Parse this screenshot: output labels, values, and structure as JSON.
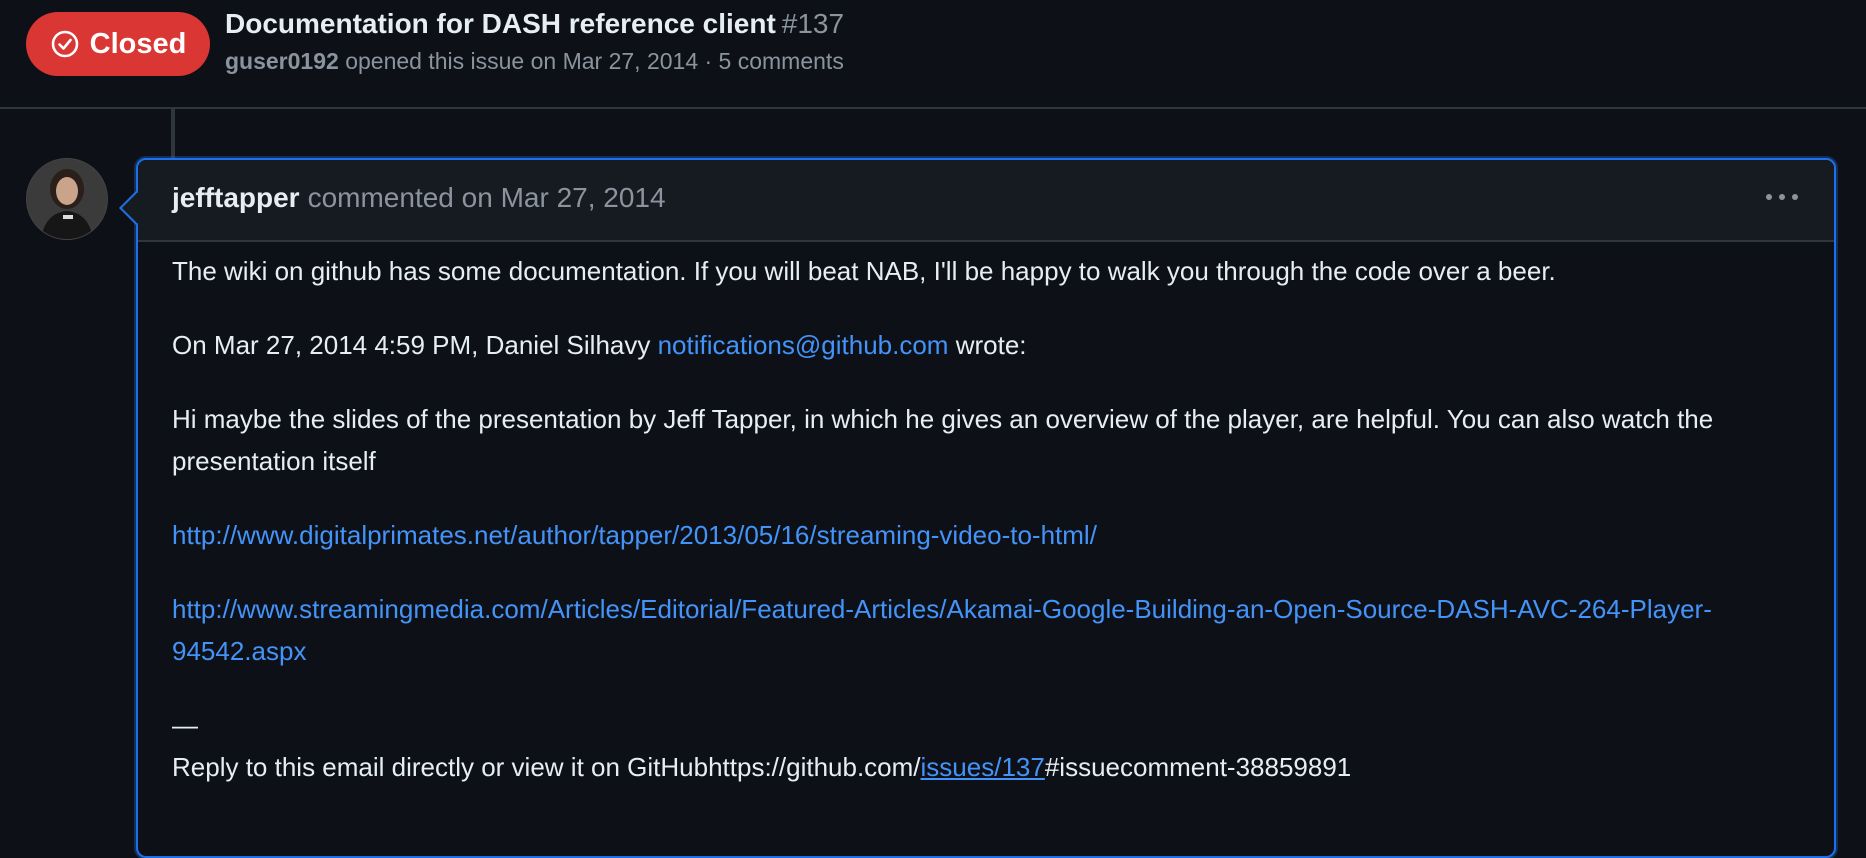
{
  "issue": {
    "state": "Closed",
    "title": "Documentation for DASH reference client",
    "number": "#137",
    "author": "guser0192",
    "meta_text": "opened this issue on Mar 27, 2014 · 5 comments"
  },
  "comment": {
    "author": "jefftapper",
    "action": "commented on Mar 27, 2014",
    "menu_icon": "kebab-horizontal-icon",
    "p1": "The wiki on github has some documentation. If you will beat NAB, I'll be happy to walk you through the code over a beer.",
    "p2_prefix": "On Mar 27, 2014 4:59 PM, Daniel Silhavy",
    "p2_email": "notifications@github.com",
    "p2_suffix": "wrote:",
    "p3": "Hi maybe the slides of the presentation by Jeff Tapper, in which he gives an overview of the player, are helpful. You can also watch the presentation itself",
    "link1": "http://www.digitalprimates.net/author/tapper/2013/05/16/streaming-video-to-html/",
    "link2": "http://www.streamingmedia.com/Articles/Editorial/Featured-Articles/Akamai-Google-Building-an-Open-Source-DASH-AVC-264-Player-94542.aspx",
    "dash": "—",
    "reply_prefix": "Reply to this email directly or view it on GitHubhttps://github.com/",
    "reply_link": "issues/137",
    "reply_suffix": "#issuecomment-38859891"
  },
  "colors": {
    "background": "#0d1117",
    "closed_badge": "#da3633",
    "link": "#4493f8",
    "focus_border": "#1f6feb"
  }
}
